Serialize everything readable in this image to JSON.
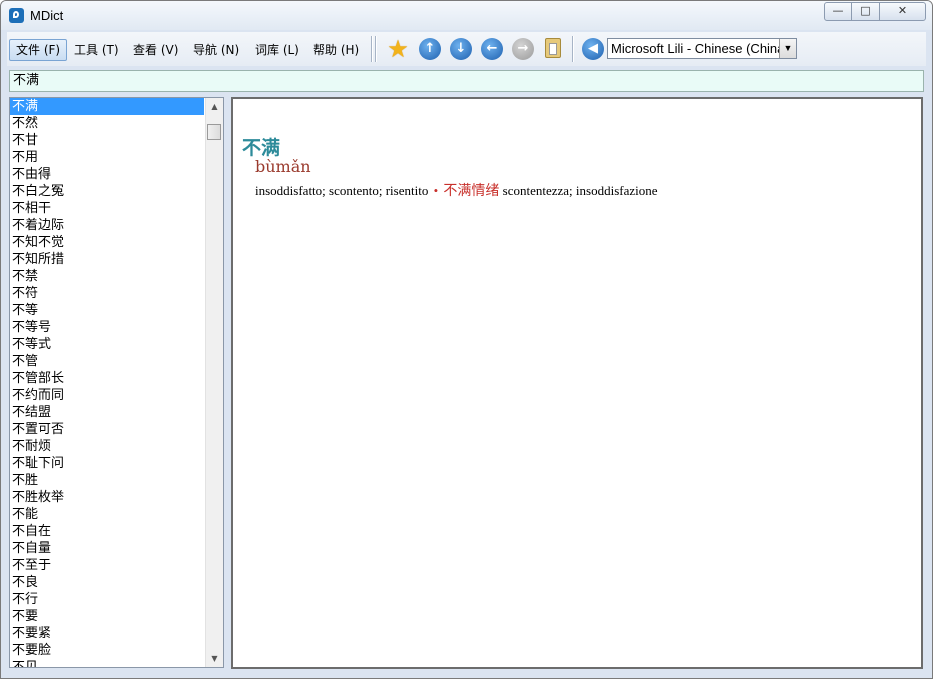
{
  "window": {
    "title": "MDict",
    "ghost_text": [
      "■■■■■",
      "■■■■■■ ■■■■■",
      "■■■■■■ ■■■■"
    ],
    "min_label": "0",
    "max_label": "▫",
    "close_label": "✕"
  },
  "menu": [
    {
      "label": "文件 (F)"
    },
    {
      "label": "工具 (T)"
    },
    {
      "label": "查看 (V)"
    },
    {
      "label": "导航 (N)"
    },
    {
      "label": "词库 (L)"
    },
    {
      "label": "帮助 (H)"
    }
  ],
  "toolbar": {
    "icons": [
      "star-icon",
      "arrow-up-icon",
      "arrow-down-icon",
      "arrow-left-icon",
      "arrow-right-icon",
      "clipboard-icon",
      "speaker-icon"
    ],
    "voice": "Microsoft Lili - Chinese (China)"
  },
  "search": {
    "value": "不满"
  },
  "word_list": [
    "不满",
    "不然",
    "不甘",
    "不用",
    "不由得",
    "不白之冤",
    "不相干",
    "不着边际",
    "不知不觉",
    "不知所措",
    "不禁",
    "不符",
    "不等",
    "不等号",
    "不等式",
    "不管",
    "不管部长",
    "不约而同",
    "不结盟",
    "不置可否",
    "不耐烦",
    "不耻下问",
    "不胜",
    "不胜枚举",
    "不能",
    "不自在",
    "不自量",
    "不至于",
    "不良",
    "不行",
    "不要",
    "不要紧",
    "不要脸",
    "不见"
  ],
  "entry": {
    "headword": "不满",
    "pinyin": "bùmǎn",
    "meaning": "insoddisfatto; scontento; risentito",
    "bullet": "•",
    "compound": "不满情绪",
    "compound_meaning": "scontentezza; insoddisfazione"
  },
  "colors": {
    "headword": "#2d8b9a",
    "pinyin": "#9a3a2d",
    "compound": "#c8302b",
    "selection": "#3399ff",
    "search_bg": "#e9fbf7"
  }
}
